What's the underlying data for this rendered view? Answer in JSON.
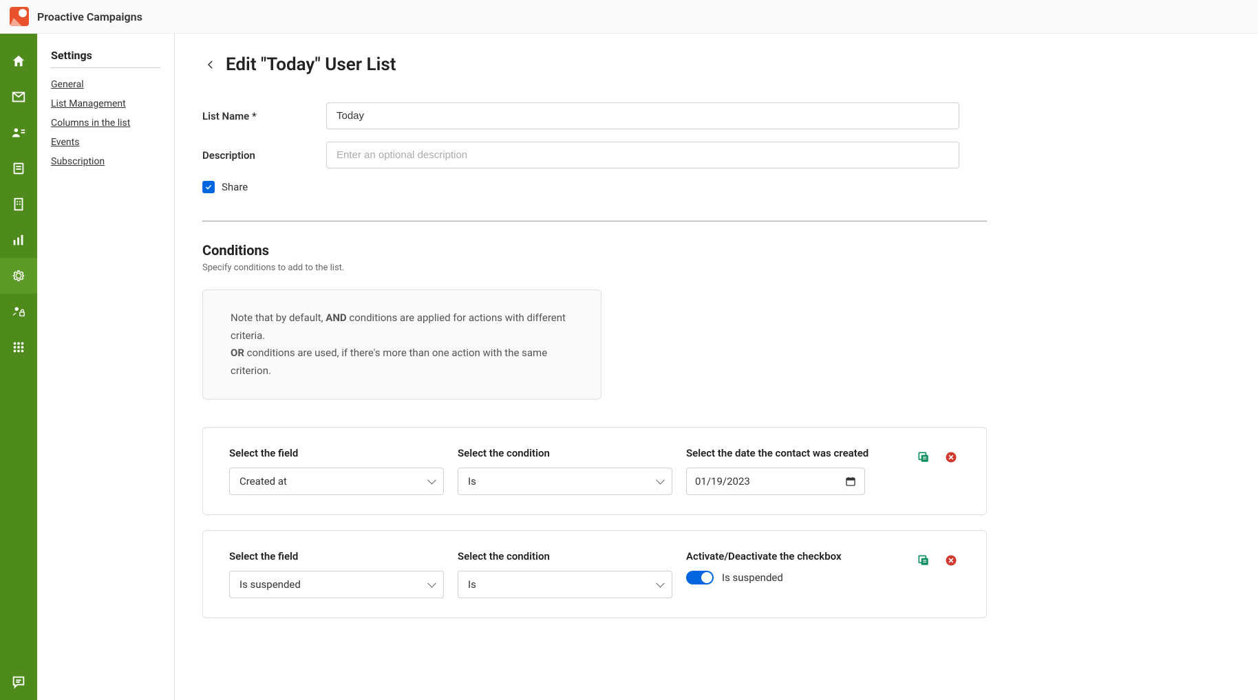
{
  "header": {
    "app_name": "Proactive Campaigns"
  },
  "settings_nav": {
    "heading": "Settings",
    "links": [
      "General",
      "List Management",
      "Columns in the list",
      "Events",
      "Subscription"
    ]
  },
  "page": {
    "title": "Edit \"Today\" User List",
    "list_name_label": "List Name *",
    "list_name_value": "Today",
    "description_label": "Description",
    "description_placeholder": "Enter an optional description",
    "share_label": "Share",
    "share_checked": true
  },
  "conditions": {
    "title": "Conditions",
    "subtitle": "Specify conditions to add to the list.",
    "note_prefix": "Note that by default, ",
    "note_and": "AND",
    "note_mid": " conditions are applied for actions with different criteria.",
    "note_or": "OR",
    "note_suffix": " conditions are used, if there's more than one action with the same criterion.",
    "col_field": "Select the field",
    "col_condition": "Select the condition",
    "col_date": "Select the date the contact was created",
    "col_checkbox": "Activate/Deactivate the checkbox",
    "rows": [
      {
        "field": "Created at",
        "condition": "Is",
        "type": "date",
        "value": "01/19/2023"
      },
      {
        "field": "Is suspended",
        "condition": "Is",
        "type": "toggle",
        "toggle_label": "Is suspended",
        "toggle_on": true
      }
    ]
  }
}
